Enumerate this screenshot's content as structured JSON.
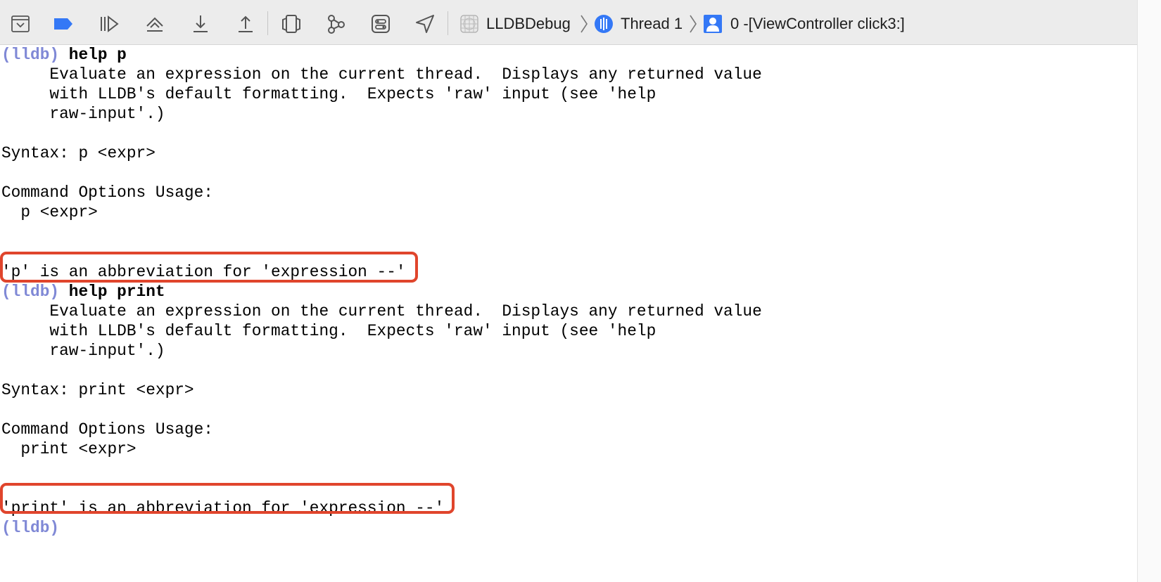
{
  "toolbar": {
    "buttons": [
      {
        "name": "hide-debug-area-icon"
      },
      {
        "name": "breakpoints-toggle-icon"
      },
      {
        "name": "continue-icon"
      },
      {
        "name": "step-over-icon"
      },
      {
        "name": "step-into-icon"
      },
      {
        "name": "step-out-icon"
      },
      {
        "name": "view-hierarchy-icon"
      },
      {
        "name": "memory-graph-icon"
      },
      {
        "name": "environment-overrides-icon"
      },
      {
        "name": "simulate-location-icon"
      }
    ],
    "breadcrumb": {
      "project": "LLDBDebug",
      "thread": "Thread 1",
      "frame": "0 -[ViewController click3:]"
    }
  },
  "console": {
    "lines": [
      {
        "prompt": "(lldb)",
        "command": "help p"
      },
      {
        "text": "     Evaluate an expression on the current thread.  Displays any returned value"
      },
      {
        "text": "     with LLDB's default formatting.  Expects 'raw' input (see 'help"
      },
      {
        "text": "     raw-input'.)"
      },
      {
        "text": ""
      },
      {
        "text": "Syntax: p <expr>"
      },
      {
        "text": ""
      },
      {
        "text": "Command Options Usage:"
      },
      {
        "text": "  p <expr>"
      },
      {
        "text": ""
      },
      {
        "text": ""
      },
      {
        "text": "'p' is an abbreviation for 'expression --'"
      },
      {
        "prompt": "(lldb)",
        "command": "help print"
      },
      {
        "text": "     Evaluate an expression on the current thread.  Displays any returned value"
      },
      {
        "text": "     with LLDB's default formatting.  Expects 'raw' input (see 'help"
      },
      {
        "text": "     raw-input'.)"
      },
      {
        "text": ""
      },
      {
        "text": "Syntax: print <expr>"
      },
      {
        "text": ""
      },
      {
        "text": "Command Options Usage:"
      },
      {
        "text": "  print <expr>"
      },
      {
        "text": ""
      },
      {
        "text": ""
      },
      {
        "text": "'print' is an abbreviation for 'expression --'"
      },
      {
        "prompt": "(lldb)",
        "command": ""
      }
    ]
  },
  "colors": {
    "prompt": "#8089d6",
    "highlight": "#e0452c",
    "toolbar_bg": "#ececec",
    "accent_blue": "#3478f6"
  }
}
